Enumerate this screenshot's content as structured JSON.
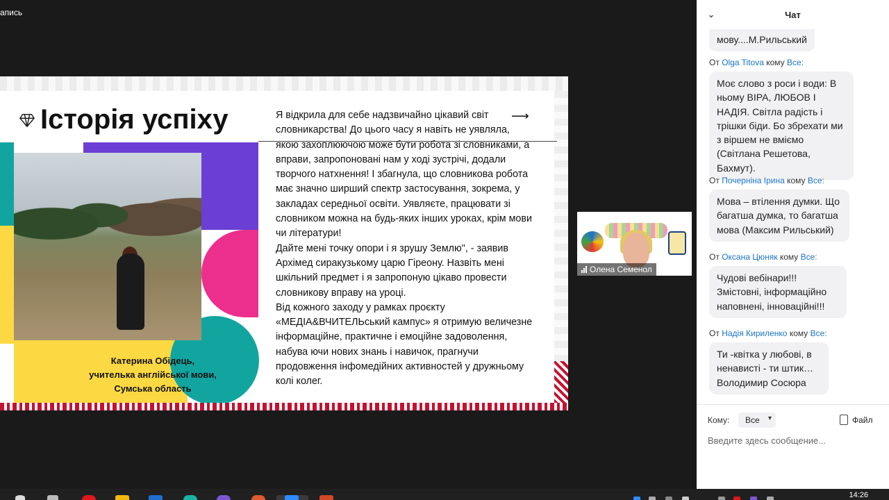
{
  "meeting": {
    "recording_label": "апись"
  },
  "slide": {
    "title": "Історія успіху",
    "arrow": "⟶",
    "caption": [
      "Катерина Обідець,",
      "учителька англійської мови,",
      "Сумська область"
    ],
    "paragraphs": [
      "Я відкрила для себе надзвичайно цікавий світ словникарства! До цього часу я навіть не уявляла, якою захоплюючою може бути робота зі словниками, а вправи, запропоновані нам у ході зустрічі, додали творчого натхнення!  І збагнула, що словникова робота має значно ширший спектр застосування, зокрема, у закладах середньої освіти. Уявляєте, працювати зі словником можна на будь-яких інших уроках, крім мови чи літератури!",
      "Дайте мені точку опори і я зрушу Землю\", - заявив Архімед сиракузькому царю Гіреону. Назвіть мені шкільний предмет і я запропоную цікаво провести словникову вправу на уроці.",
      "Від кожного заходу у рамках проєкту «МЕДІА&ВЧИТЕЛЬський кампус» я отримую величезне інформаційне, практичне і емоційне задоволення, набува ючи нових знань і навичок, прагнучи продовження інфомедійних активностей у дружньому колі колег."
    ]
  },
  "video_thumb": {
    "participant_name": "Олена Семенол"
  },
  "chat": {
    "title": "Чат",
    "from_word": "От",
    "to_word": "кому",
    "top_partial": "мову....М.Рильський",
    "messages": [
      {
        "from": "Olga Titova",
        "to": "Все:",
        "text": "Моє слово з роси і води: В ньому ВІРА, ЛЮБОВ І НАДІЯ. Світла радість і трішки біди. Бо збрехати ми з віршем не вміємо (Світлана Решетова, Бахмут)."
      },
      {
        "from": "Почерніна Ірина",
        "to": "Все:",
        "text": "Мова – втілення думки. Що багатша думка, то багатша мова (Максим Рильський)"
      },
      {
        "from": "Оксана Цюняк",
        "to": "Все:",
        "text": "Чудові вебінари!!! Змістовні, інформаційно наповнені, інноваційні!!!"
      },
      {
        "from": "Надія Кириленко",
        "to": "Все:",
        "text": "Ти -квітка у любові, в ненависті - ти штик… Володимир Сосюра"
      }
    ],
    "to_label": "Кому:",
    "to_value": "Все",
    "file_label": "Файл",
    "input_placeholder": "Введите здесь сообщение..."
  },
  "taskbar": {
    "time": "14:26"
  }
}
